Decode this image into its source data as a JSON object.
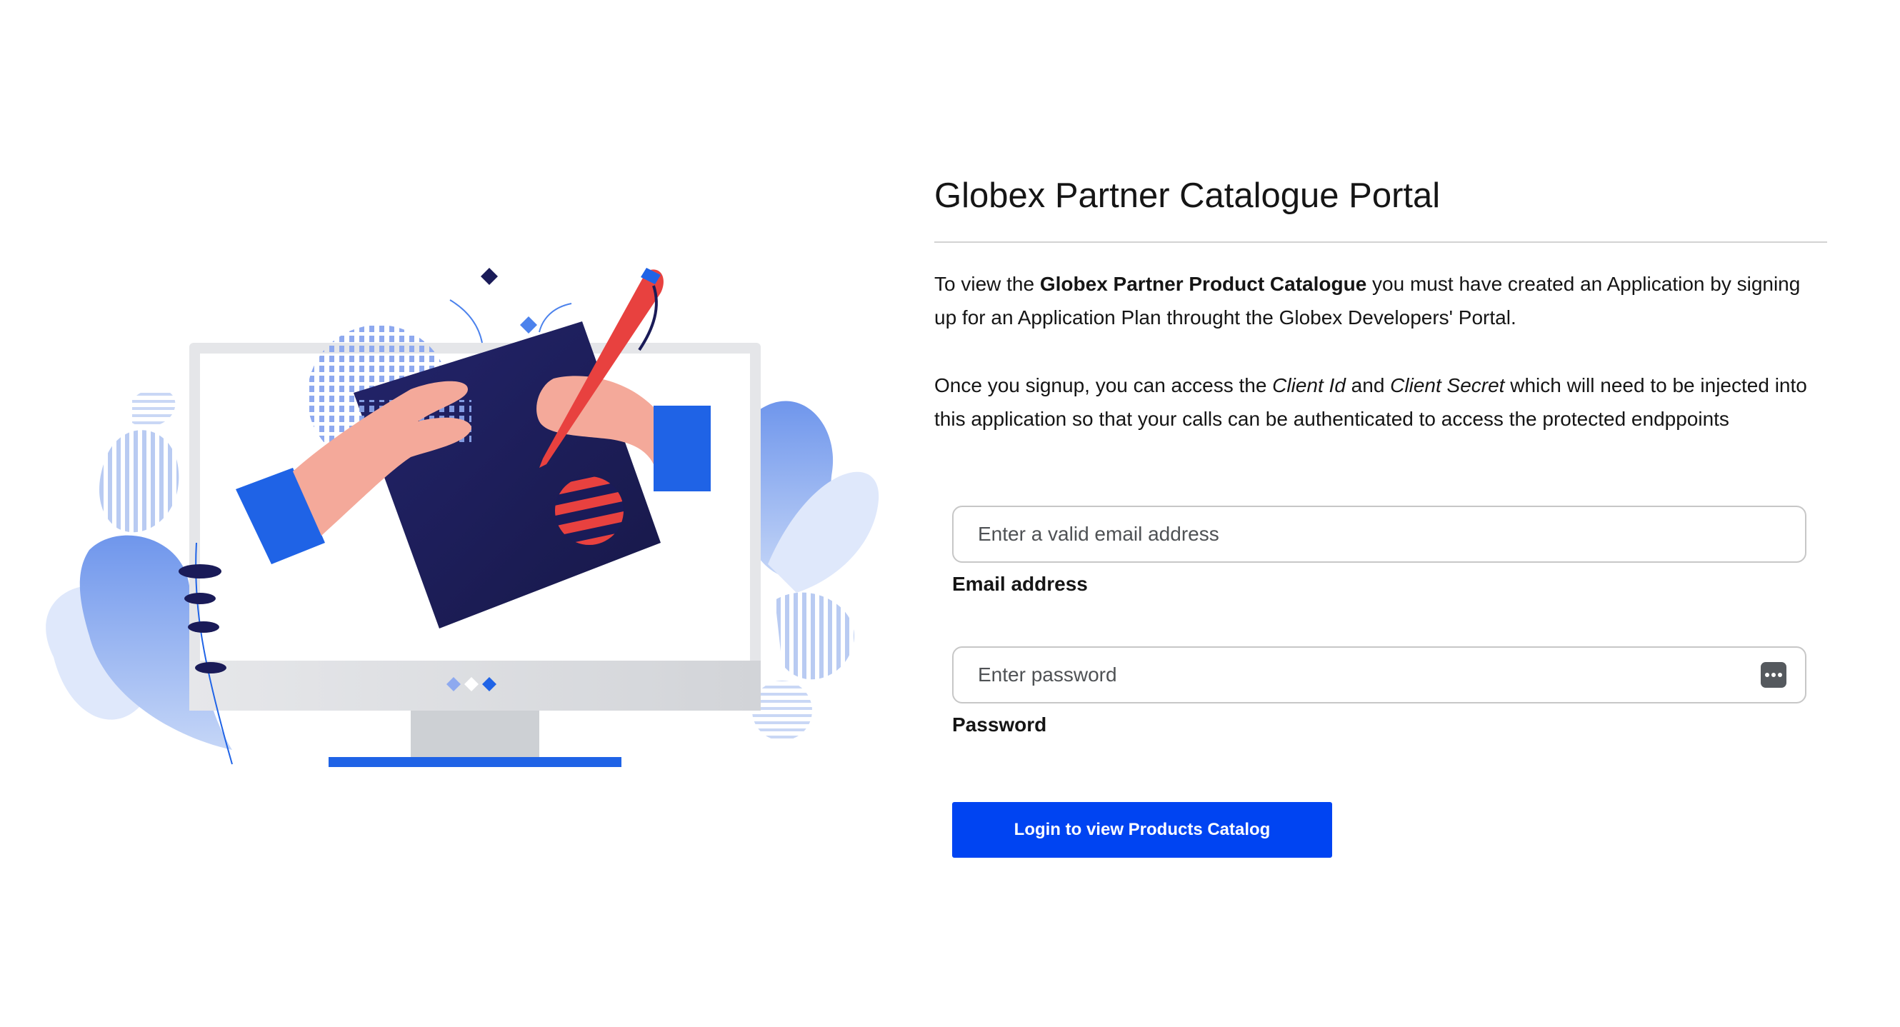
{
  "page": {
    "title": "Globex Partner Catalogue Portal"
  },
  "intro": {
    "p1_before": "To view the ",
    "p1_bold": "Globex Partner Product Catalogue",
    "p1_after": " you must have created an Application by signing up for an Application Plan throught the Globex Developers' Portal.",
    "p2_before": "Once you signup, you can access the ",
    "p2_italic_1": "Client Id",
    "p2_mid": " and ",
    "p2_italic_2": "Client Secret",
    "p2_after": " which will need to be injected into this application so that your calls can be authenticated to access the protected endppoints"
  },
  "form": {
    "email": {
      "placeholder": "Enter a valid email address",
      "value": "",
      "label": "Email address"
    },
    "password": {
      "placeholder": "Enter password",
      "value": "",
      "label": "Password",
      "icon": "password-manager-icon"
    },
    "submit_label": "Login to view Products Catalog"
  },
  "colors": {
    "primary_button": "#0044f2",
    "illustration_navy": "#1a1b58",
    "illustration_blue": "#1f63e6",
    "illustration_red": "#e8413f"
  }
}
